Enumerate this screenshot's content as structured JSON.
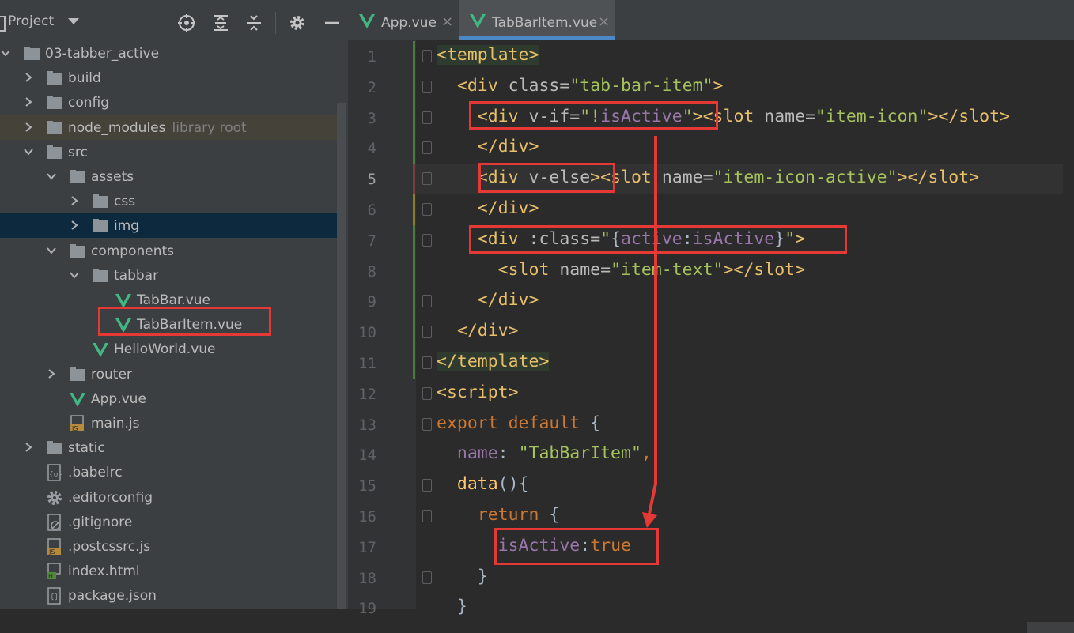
{
  "project_panel": {
    "title": "Project",
    "tree": [
      {
        "label": "03-tabber_active",
        "type": "folder",
        "depth": 0,
        "expanded": true
      },
      {
        "label": "build",
        "type": "folder",
        "depth": 1,
        "expanded": false
      },
      {
        "label": "config",
        "type": "folder",
        "depth": 1,
        "expanded": false
      },
      {
        "label": "node_modules",
        "extra": "library root",
        "type": "folder",
        "depth": 1,
        "expanded": false
      },
      {
        "label": "src",
        "type": "folder",
        "depth": 1,
        "expanded": true
      },
      {
        "label": "assets",
        "type": "folder",
        "depth": 2,
        "expanded": true
      },
      {
        "label": "css",
        "type": "folder",
        "depth": 3,
        "expanded": false
      },
      {
        "label": "img",
        "type": "folder",
        "depth": 3,
        "expanded": false
      },
      {
        "label": "components",
        "type": "folder",
        "depth": 2,
        "expanded": true
      },
      {
        "label": "tabbar",
        "type": "folder",
        "depth": 3,
        "expanded": true
      },
      {
        "label": "TabBar.vue",
        "type": "vue",
        "depth": 4
      },
      {
        "label": "TabBarItem.vue",
        "type": "vue",
        "depth": 4
      },
      {
        "label": "HelloWorld.vue",
        "type": "vue",
        "depth": 3
      },
      {
        "label": "router",
        "type": "folder",
        "depth": 2,
        "expanded": false
      },
      {
        "label": "App.vue",
        "type": "vue",
        "depth": 2
      },
      {
        "label": "main.js",
        "type": "js",
        "depth": 2
      },
      {
        "label": "static",
        "type": "folder",
        "depth": 1,
        "expanded": false
      },
      {
        "label": ".babelrc",
        "type": "config",
        "depth": 1
      },
      {
        "label": ".editorconfig",
        "type": "gear",
        "depth": 1
      },
      {
        "label": ".gitignore",
        "type": "ignore",
        "depth": 1
      },
      {
        "label": ".postcssrc.js",
        "type": "js",
        "depth": 1
      },
      {
        "label": "index.html",
        "type": "html",
        "depth": 1
      },
      {
        "label": "package.json",
        "type": "json",
        "depth": 1
      }
    ]
  },
  "editor": {
    "tabs": [
      {
        "label": "App.vue",
        "active": false
      },
      {
        "label": "TabBarItem.vue",
        "active": true
      }
    ],
    "close_glyph": "×",
    "current_line": 5,
    "lines": [
      [
        [
          "<template>",
          "tag"
        ]
      ],
      [
        [
          "  ",
          ""
        ],
        [
          "<div ",
          "tag"
        ],
        [
          "class",
          "attr"
        ],
        [
          "=",
          "attr"
        ],
        [
          "\"tab-bar-item\"",
          "str"
        ],
        [
          ">",
          "tag"
        ]
      ],
      [
        [
          "    ",
          ""
        ],
        [
          "<div ",
          "tag"
        ],
        [
          "v-if",
          "attr"
        ],
        [
          "=",
          "attr"
        ],
        [
          "\"!",
          "str"
        ],
        [
          "isActive",
          "purple"
        ],
        [
          "\"",
          "str"
        ],
        [
          ">",
          "tag"
        ],
        [
          "<slot ",
          "tag"
        ],
        [
          "name",
          "attr"
        ],
        [
          "=",
          "attr"
        ],
        [
          "\"item-icon\"",
          "str"
        ],
        [
          "></slot>",
          "tag"
        ]
      ],
      [
        [
          "    ",
          ""
        ],
        [
          "</div>",
          "tag"
        ]
      ],
      [
        [
          "    ",
          ""
        ],
        [
          "<div ",
          "tag"
        ],
        [
          "v-else",
          "attr"
        ],
        [
          ">",
          "tag"
        ],
        [
          "<slot ",
          "tag"
        ],
        [
          "name",
          "attr"
        ],
        [
          "=",
          "attr"
        ],
        [
          "\"item-icon-active\"",
          "str"
        ],
        [
          "></slot>",
          "tag"
        ]
      ],
      [
        [
          "    ",
          ""
        ],
        [
          "</div>",
          "tag"
        ]
      ],
      [
        [
          "    ",
          ""
        ],
        [
          "<div ",
          "tag"
        ],
        [
          ":class",
          "attr"
        ],
        [
          "=",
          "attr"
        ],
        [
          "\"",
          "str"
        ],
        [
          "{",
          "brace"
        ],
        [
          "active",
          "purple"
        ],
        [
          ":",
          "brace"
        ],
        [
          "isActive",
          "purple"
        ],
        [
          "}",
          "brace"
        ],
        [
          "\"",
          "str"
        ],
        [
          ">",
          "tag"
        ]
      ],
      [
        [
          "      ",
          ""
        ],
        [
          "<slot ",
          "tag"
        ],
        [
          "name",
          "attr"
        ],
        [
          "=",
          "attr"
        ],
        [
          "\"item-text\"",
          "str"
        ],
        [
          "></slot>",
          "tag"
        ]
      ],
      [
        [
          "    ",
          ""
        ],
        [
          "</div>",
          "tag"
        ]
      ],
      [
        [
          "  ",
          ""
        ],
        [
          "</div>",
          "tag"
        ]
      ],
      [
        [
          "</template>",
          "tag"
        ]
      ],
      [
        [
          "<script>",
          "tag"
        ]
      ],
      [
        [
          "export default ",
          "kw"
        ],
        [
          "{",
          "brace"
        ]
      ],
      [
        [
          "  ",
          ""
        ],
        [
          "name",
          "purple"
        ],
        [
          ": ",
          "brace"
        ],
        [
          "\"TabBarItem\"",
          "str"
        ],
        [
          ",",
          "kw"
        ]
      ],
      [
        [
          "  ",
          ""
        ],
        [
          "data",
          "fn"
        ],
        [
          "(){",
          "brace"
        ]
      ],
      [
        [
          "    ",
          ""
        ],
        [
          "return ",
          "kw"
        ],
        [
          "{",
          "brace"
        ]
      ],
      [
        [
          "      ",
          ""
        ],
        [
          "isActive",
          "purple"
        ],
        [
          ":",
          "brace"
        ],
        [
          "true",
          "kw"
        ]
      ],
      [
        [
          "    ",
          ""
        ],
        [
          "}",
          "brace"
        ]
      ],
      [
        [
          "  ",
          ""
        ],
        [
          "}",
          "brace"
        ]
      ]
    ]
  },
  "colors": {
    "annotation": "#e53935",
    "vue_green": "#41b883",
    "folder": "#8c9399"
  }
}
